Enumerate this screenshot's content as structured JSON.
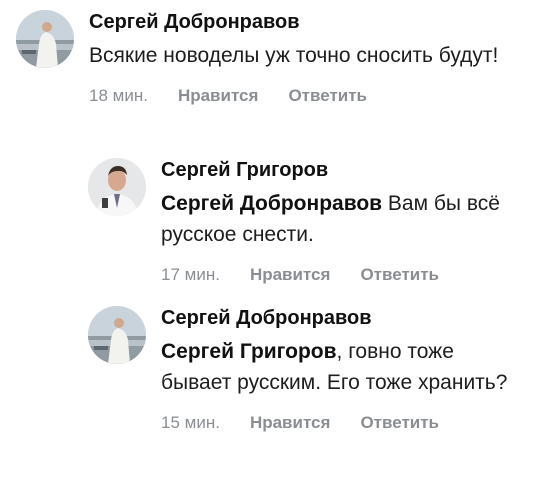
{
  "comments": [
    {
      "author": "Сергей Добронравов",
      "mention": "",
      "text": "Всякие новоделы уж точно сносить будут!",
      "time": "18 мин.",
      "like_label": "Нравится",
      "reply_label": "Ответить",
      "avatar_icon": "person-photo-avatar"
    },
    {
      "author": "Сергей Григоров",
      "mention": "Сергей Добронравов",
      "text": " Вам бы всё русское снести.",
      "time": "17 мин.",
      "like_label": "Нравится",
      "reply_label": "Ответить",
      "avatar_icon": "person-photo-avatar"
    },
    {
      "author": "Сергей Добронравов",
      "mention": "Сергей Григоров",
      "text": ", говно тоже бывает русским. Его тоже хранить?",
      "time": "15 мин.",
      "like_label": "Нравится",
      "reply_label": "Ответить",
      "avatar_icon": "person-photo-avatar"
    }
  ],
  "colors": {
    "meta_text": "#8a8e92",
    "author_text": "#111111",
    "body_text": "#1d1d1d"
  }
}
